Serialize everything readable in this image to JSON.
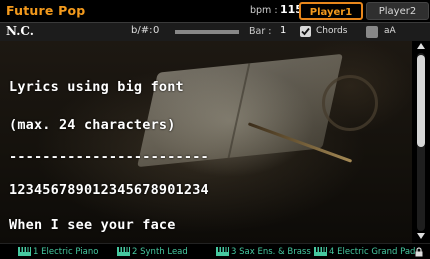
{
  "header": {
    "song_title": "Future Pop",
    "bpm_label": "bpm :",
    "bpm_value": "115",
    "player1_label": "Player1",
    "player2_label": "Player2"
  },
  "info_bar": {
    "chord": "N.C.",
    "transpose_label": "b/#:",
    "transpose_value": "0",
    "bar_label": "Bar :",
    "bar_value": "1",
    "chords_label": "Chords",
    "chords_checked": true,
    "text_size_label": "aA"
  },
  "lyrics": {
    "lines": [
      "Lyrics using big font",
      "(max. 24 characters)",
      "------------------------",
      "123456789012345678901234",
      "When I see your face"
    ]
  },
  "tracks": [
    {
      "number": "1",
      "name": "Electric Piano"
    },
    {
      "number": "2",
      "name": "Synth Lead"
    },
    {
      "number": "3",
      "name": "Sax Ens. & Brass"
    },
    {
      "number": "4",
      "name": "Electric Grand Pad"
    }
  ],
  "colors": {
    "accent_orange": "#f39a1d",
    "track_green": "#46c8a0"
  }
}
